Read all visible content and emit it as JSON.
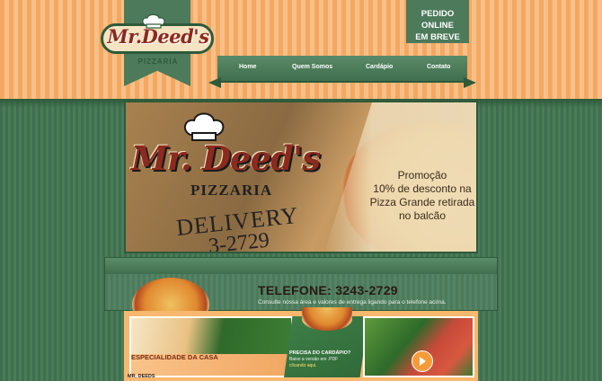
{
  "header": {
    "logo_text": "Mr.Deed's",
    "logo_sub": "PIZZARIA",
    "pedido_line1": "PEDIDO ONLINE",
    "pedido_line2": "EM BREVE"
  },
  "nav": {
    "items": [
      {
        "label": "Home"
      },
      {
        "label": "Quem Somos"
      },
      {
        "label": "Cardápio"
      },
      {
        "label": "Contato"
      }
    ]
  },
  "hero": {
    "logo_text": "Mr. Deed's",
    "logo_sub": "PIZZARIA",
    "delivery": "DELIVERY",
    "phone_partial": "3-2729",
    "promo_line1": "Promoção",
    "promo_line2": "10% de desconto na",
    "promo_line3": "Pizza Grande retirada",
    "promo_line4": "no balcão"
  },
  "telefone": {
    "title": "TELEFONE: 3243-2729",
    "note": "Consulte nossa área e valores de entrega ligando para o telefone acima."
  },
  "cards": {
    "especialidade": "ESPECIALIDADE DA CASA",
    "cardapio_title": "PRECISA DO CARDÁPIO?",
    "cardapio_line": "Baixe a versão em .PDF",
    "cardapio_link": "clicando aqui."
  },
  "footer": {
    "name": "MR. DEEDS"
  },
  "colors": {
    "green": "#4a7c59",
    "orange": "#f3a862",
    "red": "#8b2a1e"
  }
}
